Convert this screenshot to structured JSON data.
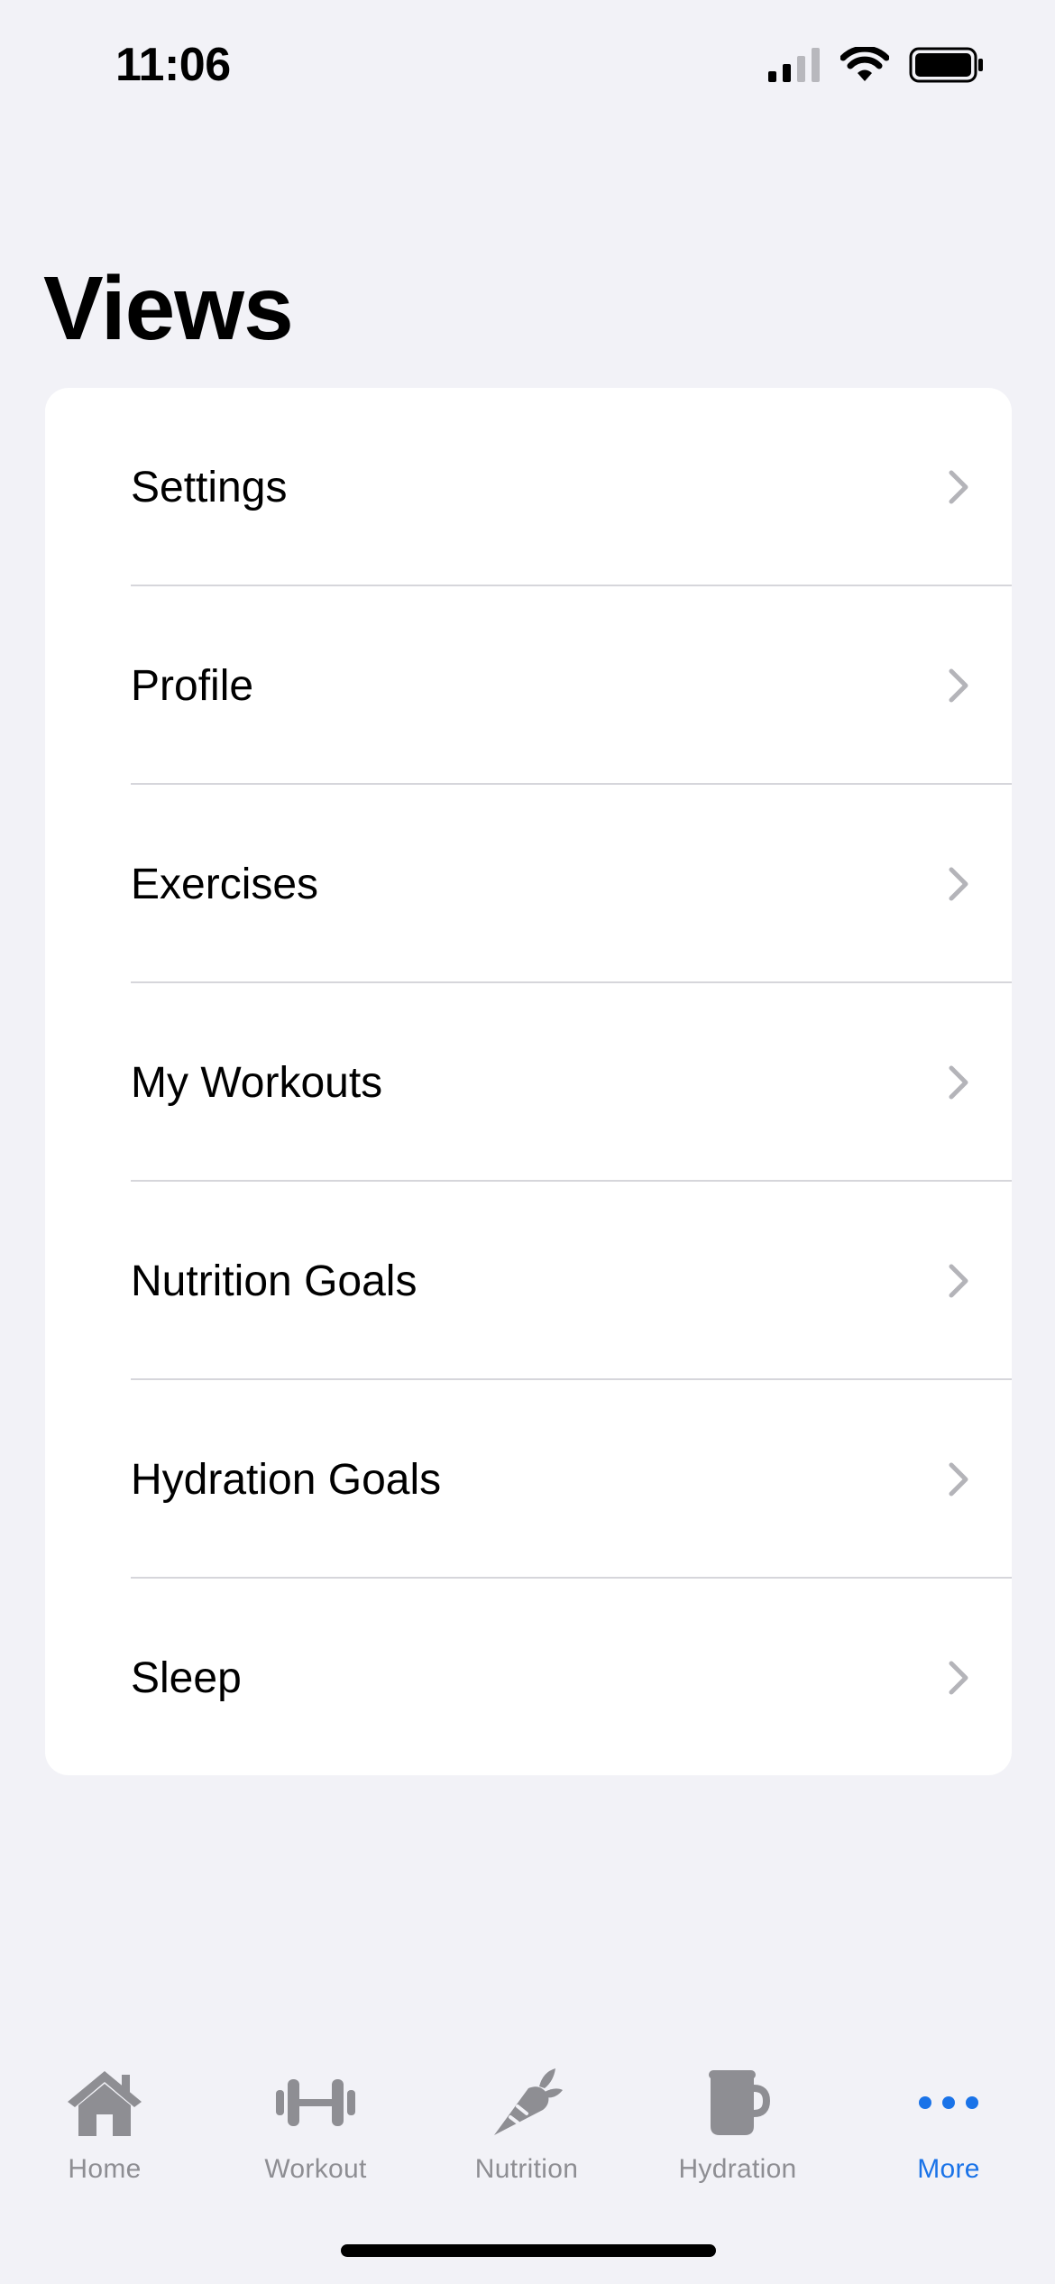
{
  "status_bar": {
    "time": "11:06"
  },
  "page": {
    "title": "Views"
  },
  "list": {
    "items": [
      {
        "label": "Settings"
      },
      {
        "label": "Profile"
      },
      {
        "label": "Exercises"
      },
      {
        "label": "My Workouts"
      },
      {
        "label": "Nutrition Goals"
      },
      {
        "label": "Hydration Goals"
      },
      {
        "label": "Sleep"
      }
    ]
  },
  "tab_bar": {
    "tabs": [
      {
        "label": "Home",
        "icon": "house-icon"
      },
      {
        "label": "Workout",
        "icon": "dumbbell-icon"
      },
      {
        "label": "Nutrition",
        "icon": "carrot-icon"
      },
      {
        "label": "Hydration",
        "icon": "mug-icon"
      },
      {
        "label": "More",
        "icon": "ellipsis-icon",
        "active": true
      }
    ]
  },
  "colors": {
    "background": "#f2f2f7",
    "accent": "#1a73e8",
    "inactive": "#8e8e93"
  }
}
